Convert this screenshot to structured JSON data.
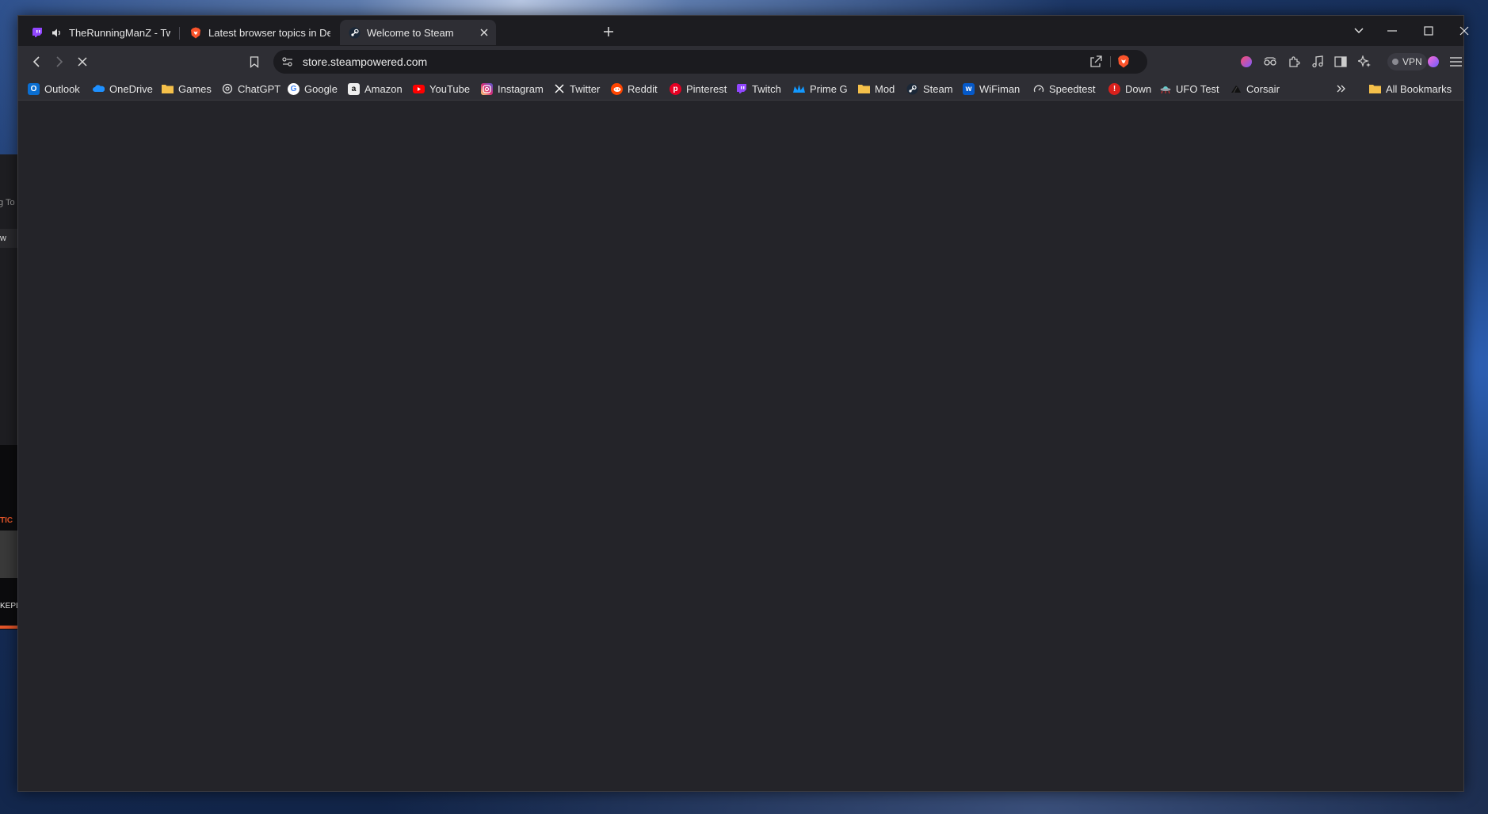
{
  "tabs": [
    {
      "title": "TheRunningManZ - Twitch",
      "audio": true
    },
    {
      "title": "Latest browser topics in Desktop Su"
    },
    {
      "title": "Welcome to Steam",
      "active": true
    }
  ],
  "toolbar": {
    "url": "store.steampowered.com",
    "vpn_label": "VPN"
  },
  "bookmarks": [
    {
      "label": "Outlook",
      "icon": "outlook-icon"
    },
    {
      "label": "OneDrive",
      "icon": "onedrive-icon"
    },
    {
      "label": "Games",
      "icon": "folder-icon"
    },
    {
      "label": "ChatGPT",
      "icon": "chatgpt-icon"
    },
    {
      "label": "Google",
      "icon": "google-icon"
    },
    {
      "label": "Amazon",
      "icon": "amazon-icon"
    },
    {
      "label": "YouTube",
      "icon": "youtube-icon"
    },
    {
      "label": "Instagram",
      "icon": "instagram-icon"
    },
    {
      "label": "Twitter",
      "icon": "x-icon"
    },
    {
      "label": "Reddit",
      "icon": "reddit-icon"
    },
    {
      "label": "Pinterest",
      "icon": "pinterest-icon"
    },
    {
      "label": "Twitch",
      "icon": "twitch-icon"
    },
    {
      "label": "Prime G",
      "icon": "prime-icon"
    },
    {
      "label": "Mod",
      "icon": "folder-icon"
    },
    {
      "label": "Steam",
      "icon": "steam-icon"
    },
    {
      "label": "WiFiman",
      "icon": "wifiman-icon"
    },
    {
      "label": "Speedtest",
      "icon": "speedtest-icon"
    },
    {
      "label": "Down",
      "icon": "down-icon"
    },
    {
      "label": "UFO Test",
      "icon": "ufo-icon"
    },
    {
      "label": "Corsair",
      "icon": "corsair-icon"
    }
  ],
  "all_bookmarks_label": "All Bookmarks",
  "background_app": {
    "text1": "g To",
    "text2": "w",
    "text3": "TIC",
    "text4": "KEPL"
  },
  "colors": {
    "frame": "#1c1c20",
    "toolbar": "#2e2e34",
    "content": "#242429",
    "brave_orange": "#fb542b"
  }
}
